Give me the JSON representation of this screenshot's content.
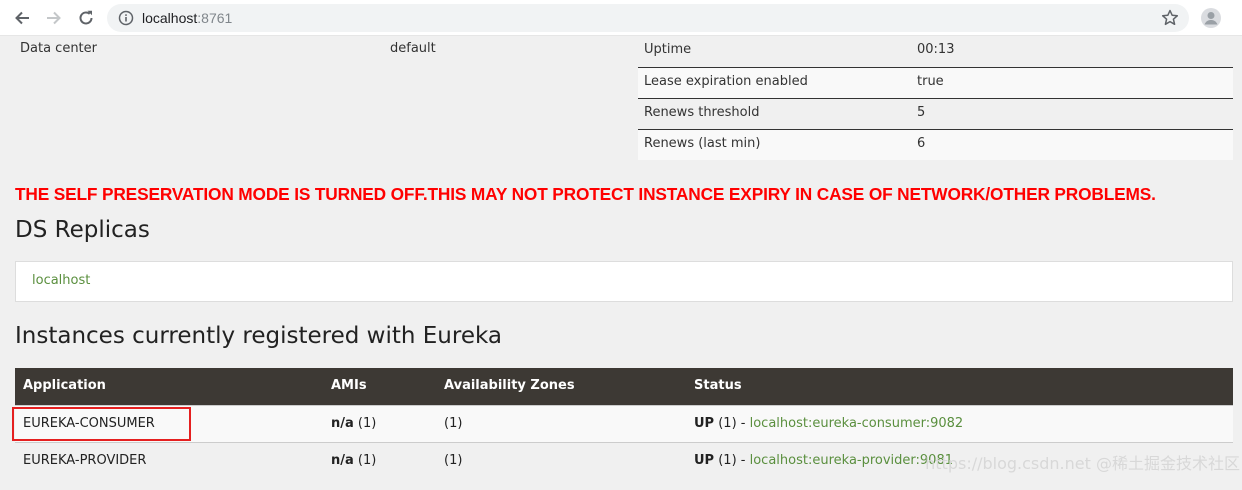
{
  "browser": {
    "url_host": "localhost",
    "url_port": ":8761"
  },
  "data_center": {
    "label": "Data center",
    "value": "default"
  },
  "system_status": [
    {
      "label": "Uptime",
      "value": "00:13"
    },
    {
      "label": "Lease expiration enabled",
      "value": "true"
    },
    {
      "label": "Renews threshold",
      "value": "5"
    },
    {
      "label": "Renews (last min)",
      "value": "6"
    }
  ],
  "warning": "THE SELF PRESERVATION MODE IS TURNED OFF.THIS MAY NOT PROTECT INSTANCE EXPIRY IN CASE OF NETWORK/OTHER PROBLEMS.",
  "ds_replicas": {
    "title": "DS Replicas",
    "link": "localhost"
  },
  "instances": {
    "title": "Instances currently registered with Eureka",
    "headers": [
      "Application",
      "AMIs",
      "Availability Zones",
      "Status"
    ],
    "rows": [
      {
        "application": "EUREKA-CONSUMER",
        "ami": "n/a",
        "ami_count": " (1)",
        "zones": "(1)",
        "status": "UP",
        "status_count": " (1) - ",
        "instance_link": "localhost:eureka-consumer:9082"
      },
      {
        "application": "EUREKA-PROVIDER",
        "ami": "n/a",
        "ami_count": " (1)",
        "zones": "(1)",
        "status": "UP",
        "status_count": " (1) - ",
        "instance_link": "localhost:eureka-provider:9081"
      }
    ]
  },
  "watermark": "https://blog.csdn.net @稀土掘金技术社区",
  "colors": {
    "warning": "#ff0000",
    "link": "#5a8f3e",
    "table_header": "#3d3934",
    "highlight": "#e52020"
  }
}
